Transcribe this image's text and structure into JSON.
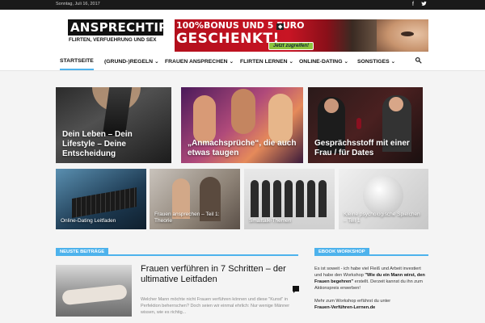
{
  "topbar": {
    "date": "Sonntag, Juli 16, 2017",
    "social": [
      {
        "icon": "facebook-icon",
        "glyph": "f"
      },
      {
        "icon": "twitter-icon",
        "glyph": "🐦"
      }
    ]
  },
  "logo": {
    "line1": "ANSPRECHTIPPS",
    "line2": "FLIRTEN, VERFUEHRUNG UND SEX"
  },
  "banner": {
    "line1": "100%BONUS UND 5 EURO",
    "line2": "GESCHENKT!",
    "cta": "Jetzt zugreifen!"
  },
  "nav": {
    "items": [
      "STARTSEITE",
      "(GRUND-)REGELN",
      "FRAUEN ANSPRECHEN",
      "FLIRTEN LERNEN",
      "ONLINE-DATING",
      "SONSTIGES"
    ],
    "active": 0,
    "search_icon": "search-icon"
  },
  "featured": [
    {
      "title": "Dein Leben – Dein Lifestyle – Deine Entscheidung"
    },
    {
      "title": "„Anmachsprüche“, die auch etwas taugen"
    },
    {
      "title": "Gesprächsstoff mit einer Frau / für Dates"
    }
  ],
  "small_tiles": [
    {
      "title": "Online-Dating Leitfaden"
    },
    {
      "title": "Frauen ansprechen – Teil 1: Theorie"
    },
    {
      "title": "Smalltalk-Themen"
    },
    {
      "title": "Kleine psychologische Spielchen – Teil 1"
    }
  ],
  "sections": {
    "latest": "NEUSTE BEITRÄGE",
    "ebook": "EBOOK WORKSHOP"
  },
  "post": {
    "title": "Frauen verführen in 7 Schritten – der ultimative Leitfaden",
    "excerpt": "Welcher Mann möchte nicht Frauen verführen können und diese \"Kunst\" in Perfektion beherrschen? Doch seien wir einmal ehrlich: Nur wenige Männer wissen, wie es richtig..."
  },
  "sidebar": {
    "p1_pre": "Es ist soweit - ich habe viel Fleiß und Arbeit investiert und habe den Workshop ",
    "p1_bold": "\"Wie du ein Mann wirst, den Frauen begehren\"",
    "p1_post": " erstellt. Derzeit kannst du ihn zum Aktionspreis erwerben!",
    "p2": "Mehr zum Workshop erfährst du unter",
    "p2_link": "Frauen-Verführen-Lernen.de"
  }
}
